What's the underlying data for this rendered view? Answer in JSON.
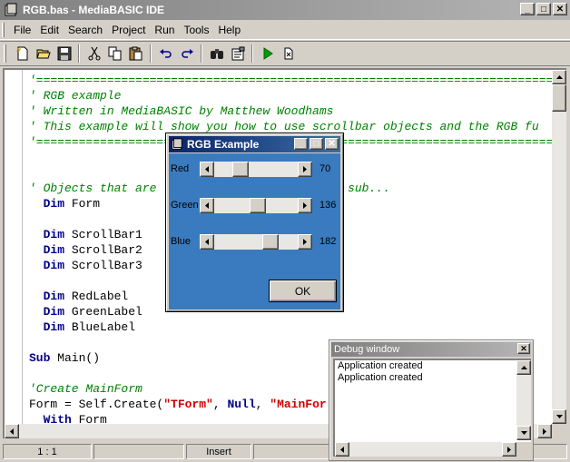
{
  "window": {
    "title": "RGB.bas - MediaBASIC IDE",
    "min": "_",
    "max": "□",
    "close": "✕"
  },
  "menu": [
    "File",
    "Edit",
    "Search",
    "Project",
    "Run",
    "Tools",
    "Help"
  ],
  "toolbar": {
    "icons": [
      "new-file-icon",
      "open-folder-icon",
      "save-icon",
      "cut-icon",
      "copy-icon",
      "paste-icon",
      "undo-icon",
      "redo-icon",
      "find-icon",
      "properties-icon",
      "run-icon",
      "stop-icon"
    ]
  },
  "code": [
    [
      [
        "cm",
        "'====================================================================================="
      ]
    ],
    [
      [
        "cm",
        "' RGB example"
      ]
    ],
    [
      [
        "cm",
        "' Written in MediaBASIC by Matthew Woodhams"
      ]
    ],
    [
      [
        "cm",
        "' This example will show you how to use scrollbar objects and the RGB fu"
      ]
    ],
    [
      [
        "cm",
        "'====================================================================================="
      ]
    ],
    [],
    [],
    [
      [
        "cm",
        "' Objects that are                        al sub..."
      ]
    ],
    [
      [
        "plain",
        "  "
      ],
      [
        "kw",
        "Dim"
      ],
      [
        "plain",
        " Form"
      ]
    ],
    [],
    [
      [
        "plain",
        "  "
      ],
      [
        "kw",
        "Dim"
      ],
      [
        "plain",
        " ScrollBar1"
      ]
    ],
    [
      [
        "plain",
        "  "
      ],
      [
        "kw",
        "Dim"
      ],
      [
        "plain",
        " ScrollBar2"
      ]
    ],
    [
      [
        "plain",
        "  "
      ],
      [
        "kw",
        "Dim"
      ],
      [
        "plain",
        " ScrollBar3"
      ]
    ],
    [],
    [
      [
        "plain",
        "  "
      ],
      [
        "kw",
        "Dim"
      ],
      [
        "plain",
        " RedLabel"
      ]
    ],
    [
      [
        "plain",
        "  "
      ],
      [
        "kw",
        "Dim"
      ],
      [
        "plain",
        " GreenLabel"
      ]
    ],
    [
      [
        "plain",
        "  "
      ],
      [
        "kw",
        "Dim"
      ],
      [
        "plain",
        " BlueLabel"
      ]
    ],
    [],
    [
      [
        "kw",
        "Sub"
      ],
      [
        "plain",
        " Main()"
      ]
    ],
    [],
    [
      [
        "cm",
        "'Create MainForm"
      ]
    ],
    [
      [
        "plain",
        "Form = Self.Create("
      ],
      [
        "str",
        "\"TForm\""
      ],
      [
        "plain",
        ", "
      ],
      [
        "kw",
        "Null"
      ],
      [
        "plain",
        ", "
      ],
      [
        "str",
        "\"MainFor"
      ]
    ],
    [
      [
        "plain",
        "  "
      ],
      [
        "kw",
        "With"
      ],
      [
        "plain",
        " Form"
      ]
    ]
  ],
  "status": {
    "position": "1 : 1",
    "mode": "Insert"
  },
  "rgb_dialog": {
    "title": "RGB Example",
    "sliders": [
      {
        "label": "Red",
        "value": "70",
        "level": 70
      },
      {
        "label": "Green",
        "value": "136",
        "level": 136
      },
      {
        "label": "Blue",
        "value": "182",
        "level": 182
      }
    ],
    "ok_label": "OK",
    "bg_color": "#3a7bbf"
  },
  "debug": {
    "title": "Debug window",
    "lines": [
      "Application created",
      "Application created"
    ]
  }
}
